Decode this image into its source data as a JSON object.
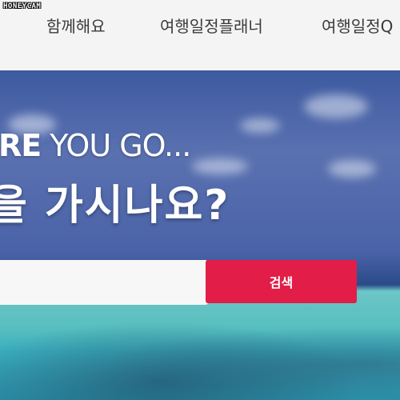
{
  "watermark": "HONEYCAM",
  "nav": {
    "items": [
      {
        "label": "함께해요"
      },
      {
        "label": "여행일정플래너"
      },
      {
        "label": "여행일정Q"
      }
    ]
  },
  "hero": {
    "heading_bold": "RE",
    "heading_rest": " YOU GO...",
    "subheading": "을 가시나요?"
  },
  "search": {
    "value": "",
    "placeholder": "",
    "button_label": "검색"
  },
  "colors": {
    "accent": "#e11d48"
  }
}
